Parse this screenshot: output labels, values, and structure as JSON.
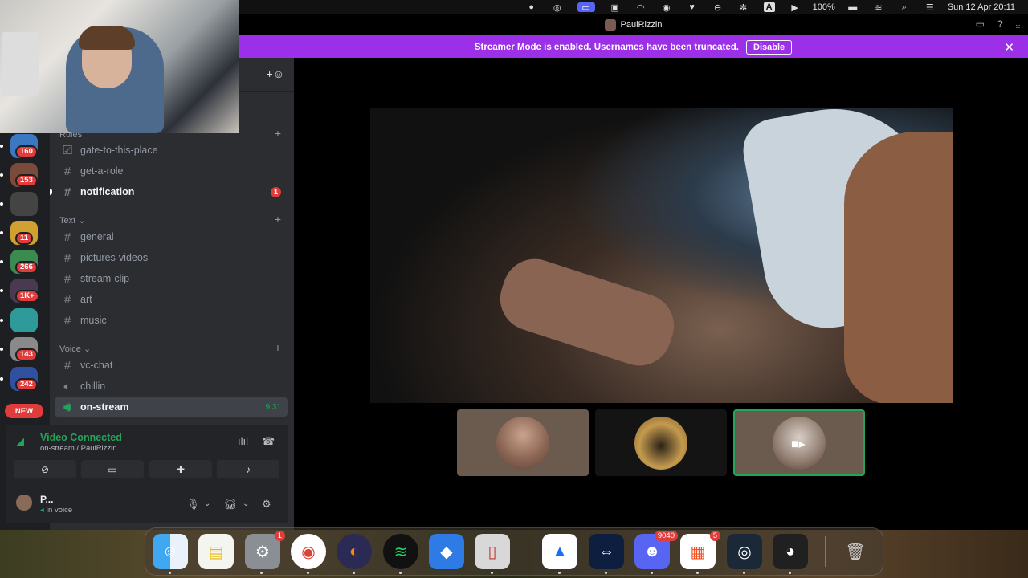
{
  "menubar": {
    "battery": "100%",
    "datetime": "Sun 12 Apr  20:11",
    "a_label": "A"
  },
  "window": {
    "title": "PaulRizzin"
  },
  "banner": {
    "text": "Streamer Mode is enabled. Usernames have been truncated.",
    "disable_label": "Disable"
  },
  "servers": [
    {
      "badge": "160",
      "color": "#3a78c2"
    },
    {
      "badge": "153",
      "color": "#7a4b3a"
    },
    {
      "badge": "",
      "color": "#444"
    },
    {
      "badge": "11",
      "color": "#d0a030"
    },
    {
      "badge": "266",
      "color": "#3b8a50"
    },
    {
      "badge": "1K+",
      "color": "#4a3a50"
    },
    {
      "badge": "",
      "color": "#2f9a9a"
    },
    {
      "badge": "143",
      "color": "#8a8a8a"
    },
    {
      "badge": "242",
      "color": "#3050a0"
    }
  ],
  "server_new_label": "NEW",
  "categories": {
    "top": "Rules",
    "text": "Text",
    "voice": "Voice"
  },
  "channels": [
    {
      "name": "gate-to-this-place",
      "icon": "checkbox-icon"
    },
    {
      "name": "get-a-role",
      "icon": "hash-icon"
    },
    {
      "name": "notification",
      "icon": "hash-icon",
      "badge": "1"
    },
    {
      "name": "general",
      "icon": "hash-icon"
    },
    {
      "name": "pictures-videos",
      "icon": "hash-icon"
    },
    {
      "name": "stream-clip",
      "icon": "hash-icon"
    },
    {
      "name": "art",
      "icon": "hash-icon"
    },
    {
      "name": "music",
      "icon": "hash-icon"
    },
    {
      "name": "vc-chat",
      "icon": "hash-icon"
    },
    {
      "name": "chillin",
      "icon": "speaker-icon"
    },
    {
      "name": "on-stream",
      "icon": "speaker-icon",
      "time": "9:31"
    }
  ],
  "voice_panel": {
    "title": "Video Connected",
    "subtitle": "on-stream / PaulRizzin"
  },
  "user": {
    "name": "P...",
    "status": "In voice"
  },
  "dock": {
    "settings_badge": "1",
    "discord_badge": "9040",
    "store_badge": "5"
  },
  "colors": {
    "accent_purple": "#9b30e8",
    "connected_green": "#23a559",
    "badge_red": "#e13c3c",
    "blurple": "#5865f2"
  }
}
